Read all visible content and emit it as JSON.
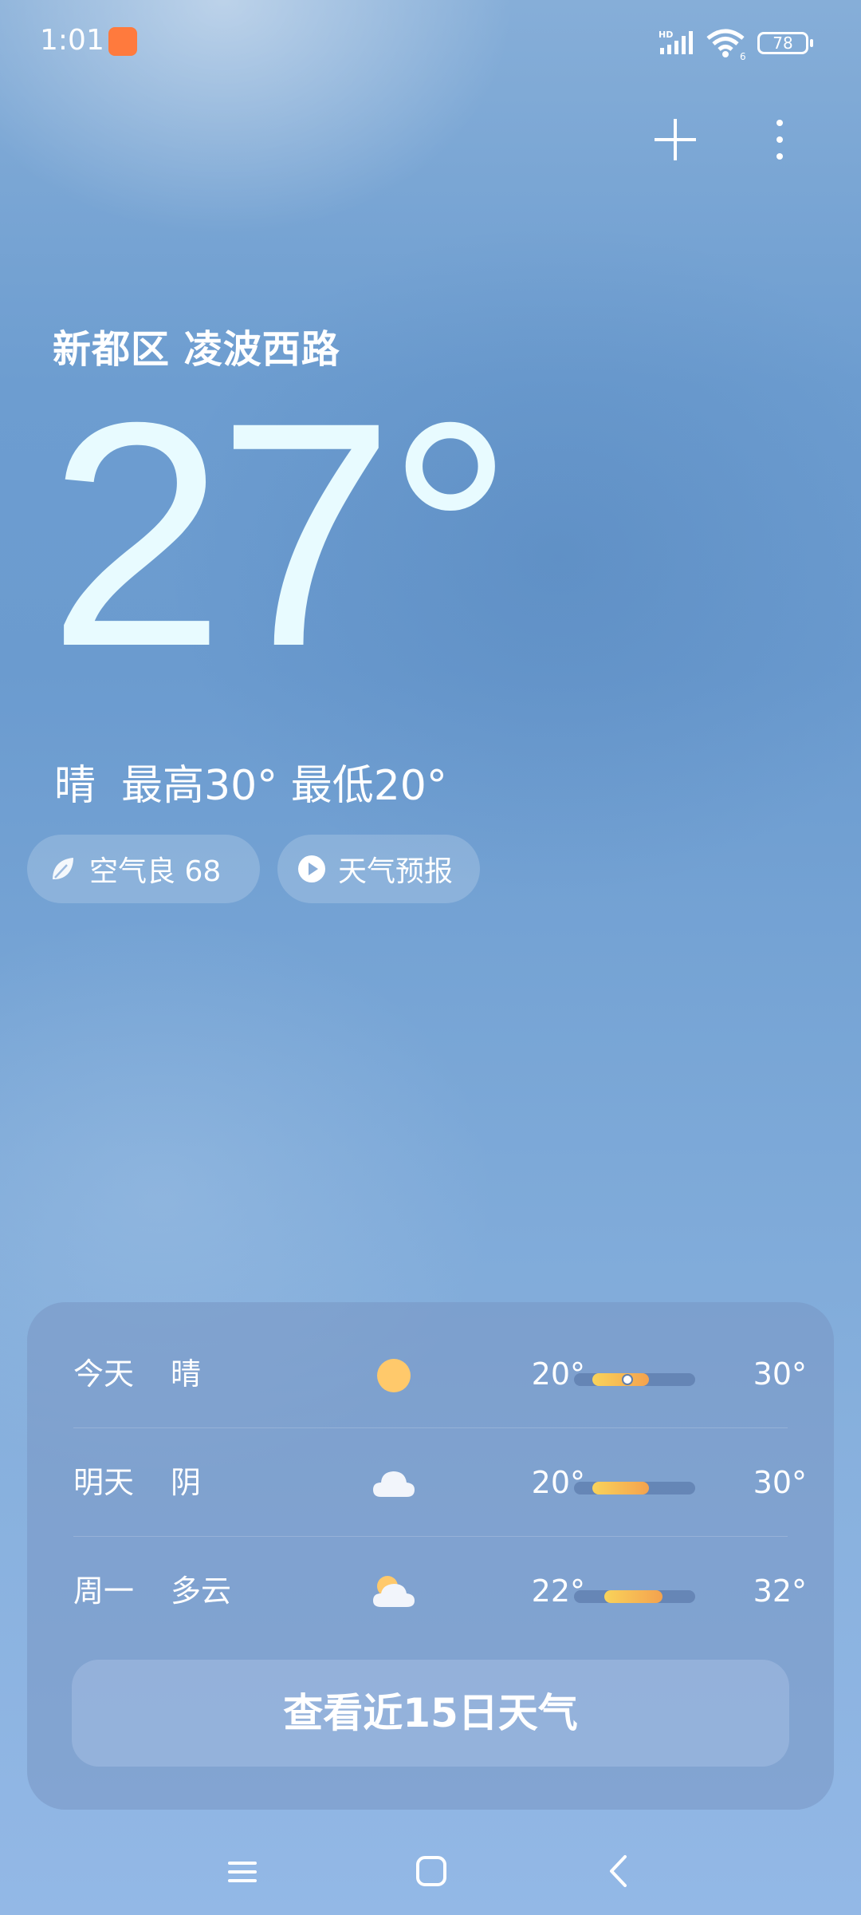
{
  "status_bar": {
    "time": "1:01",
    "battery": "78",
    "network": "HD",
    "wifi_badge": "6"
  },
  "location": "新都区 凌波西路",
  "current": {
    "temperature": "27°",
    "condition": "晴",
    "high": "最高30°",
    "low": "最低20°"
  },
  "chips": {
    "air_quality": "空气良 68",
    "forecast": "天气预报"
  },
  "forecast": {
    "days": [
      {
        "label": "今天",
        "condition": "晴",
        "icon": "sun-icon",
        "low": "20°",
        "high": "30°",
        "range_start": 0.15,
        "range_end": 0.62,
        "current_marker": 0.44
      },
      {
        "label": "明天",
        "condition": "阴",
        "icon": "cloud-icon",
        "low": "20°",
        "high": "30°",
        "range_start": 0.15,
        "range_end": 0.62
      },
      {
        "label": "周一",
        "condition": "多云",
        "icon": "partly-cloudy-icon",
        "low": "22°",
        "high": "32°",
        "range_start": 0.25,
        "range_end": 0.73
      }
    ],
    "view_more_label": "查看近15日天气"
  },
  "colors": {
    "range_start": "#f9d35a",
    "range_end": "#f4a24e",
    "sun": "#ffc96b"
  }
}
